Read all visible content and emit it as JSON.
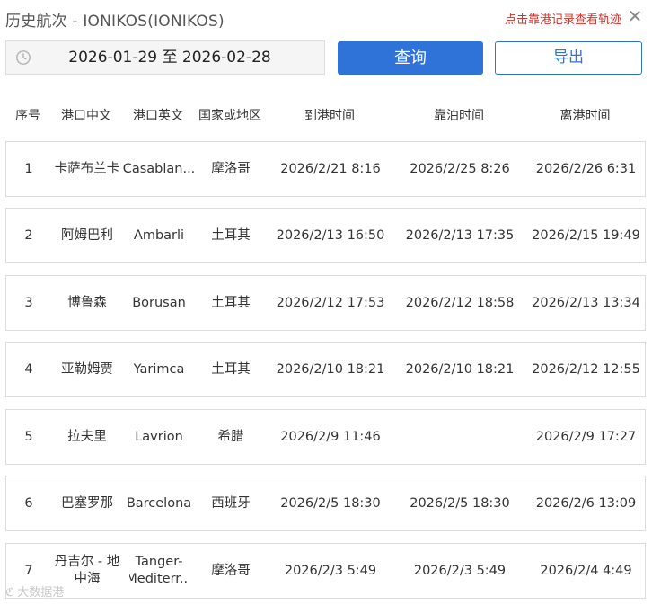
{
  "header": {
    "title": "历史航次 - IONIKOS(IONIKOS)",
    "hint": "点击靠港记录查看轨迹",
    "close_glyph": "✕"
  },
  "filter": {
    "date_range": "2026-01-29 至 2026-02-28",
    "icon": "clock-icon"
  },
  "buttons": {
    "query": "查询",
    "export": "导出"
  },
  "columns": [
    "序号",
    "港口中文",
    "港口英文",
    "国家或地区",
    "到港时间",
    "靠泊时间",
    "离港时间"
  ],
  "rows": [
    {
      "no": "1",
      "port_cn": "卡萨布兰卡",
      "port_en": "Casablan...",
      "country": "摩洛哥",
      "arrival": "2026/2/21 8:16",
      "berth": "2026/2/25 8:26",
      "departure": "2026/2/26 6:31"
    },
    {
      "no": "2",
      "port_cn": "阿姆巴利",
      "port_en": "Ambarli",
      "country": "土耳其",
      "arrival": "2026/2/13 16:50",
      "berth": "2026/2/13 17:35",
      "departure": "2026/2/15 19:49"
    },
    {
      "no": "3",
      "port_cn": "博鲁森",
      "port_en": "Borusan",
      "country": "土耳其",
      "arrival": "2026/2/12 17:53",
      "berth": "2026/2/12 18:58",
      "departure": "2026/2/13 13:34"
    },
    {
      "no": "4",
      "port_cn": "亚勒姆贾",
      "port_en": "Yarimca",
      "country": "土耳其",
      "arrival": "2026/2/10 18:21",
      "berth": "2026/2/10 18:21",
      "departure": "2026/2/12 12:55"
    },
    {
      "no": "5",
      "port_cn": "拉夫里",
      "port_en": "Lavrion",
      "country": "希腊",
      "arrival": "2026/2/9 11:46",
      "berth": "",
      "departure": "2026/2/9 17:27"
    },
    {
      "no": "6",
      "port_cn": "巴塞罗那",
      "port_en": "Barcelona",
      "country": "西班牙",
      "arrival": "2026/2/5 18:30",
      "berth": "2026/2/5 18:30",
      "departure": "2026/2/6 13:09"
    },
    {
      "no": "7",
      "port_cn": "丹吉尔 - 地中海",
      "port_en": "Tanger-Mediterr...",
      "country": "摩洛哥",
      "arrival": "2026/2/3 5:49",
      "berth": "2026/2/3 5:49",
      "departure": "2026/2/4 4:49"
    }
  ],
  "watermark": "大数据港"
}
